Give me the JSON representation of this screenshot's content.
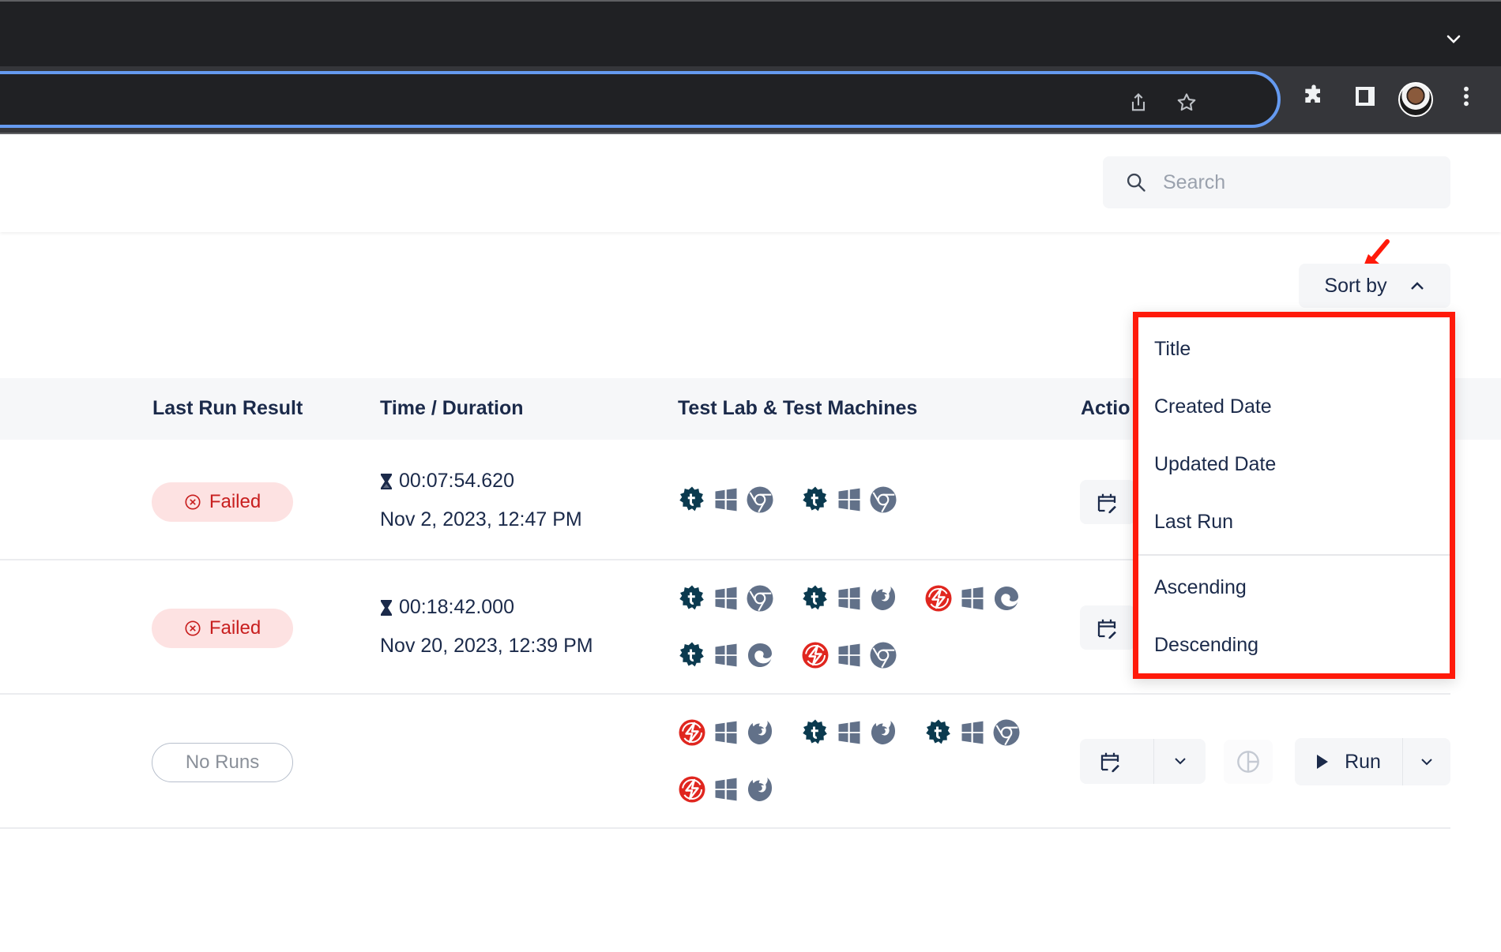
{
  "browser": {
    "tab_strip_chevron": "chevron-down-icon",
    "toolbar_icons": [
      "share-icon",
      "bookmark-star-icon",
      "extensions-icon",
      "side-panel-icon",
      "profile-avatar",
      "more-menu-icon"
    ]
  },
  "header": {
    "search": {
      "placeholder": "Search",
      "value": ""
    }
  },
  "sort": {
    "label": "Sort by",
    "expanded": true,
    "options": [
      "Title",
      "Created Date",
      "Updated Date",
      "Last Run"
    ],
    "order_options": [
      "Ascending",
      "Descending"
    ]
  },
  "table": {
    "columns": [
      "Last Run Result",
      "Time / Duration",
      "Test Lab & Test Machines",
      "Actio"
    ],
    "rows": [
      {
        "status": "Failed",
        "status_type": "failed",
        "duration": "00:07:54.620",
        "date": "Nov 2, 2023, 12:47 PM",
        "machines": [
          [
            "testingbot",
            "windows",
            "chrome"
          ],
          [
            "testingbot",
            "windows",
            "chrome"
          ]
        ]
      },
      {
        "status": "Failed",
        "status_type": "failed",
        "duration": "00:18:42.000",
        "date": "Nov 20, 2023, 12:39 PM",
        "machines": [
          [
            "testingbot",
            "windows",
            "chrome"
          ],
          [
            "testingbot",
            "windows",
            "firefox"
          ],
          [
            "lambdatest",
            "windows",
            "edge"
          ],
          [
            "testingbot",
            "windows",
            "edge"
          ],
          [
            "lambdatest",
            "windows",
            "chrome"
          ]
        ]
      },
      {
        "status": "No Runs",
        "status_type": "none",
        "duration": "",
        "date": "",
        "machines": [
          [
            "lambdatest",
            "windows",
            "firefox"
          ],
          [
            "testingbot",
            "windows",
            "firefox"
          ],
          [
            "testingbot",
            "windows",
            "chrome"
          ],
          [
            "lambdatest",
            "windows",
            "firefox"
          ]
        ],
        "run_label": "Run"
      }
    ]
  },
  "colors": {
    "accent_red": "#ff1a0a",
    "failed_text": "#c81e1e",
    "failed_bg": "#fde2e2",
    "text_primary": "#1b2a4a",
    "icon_gray": "#627189",
    "testingbot_teal": "#0b3a4f",
    "lambdatest_red": "#e0261f",
    "omnibox_focus": "#659af0"
  }
}
